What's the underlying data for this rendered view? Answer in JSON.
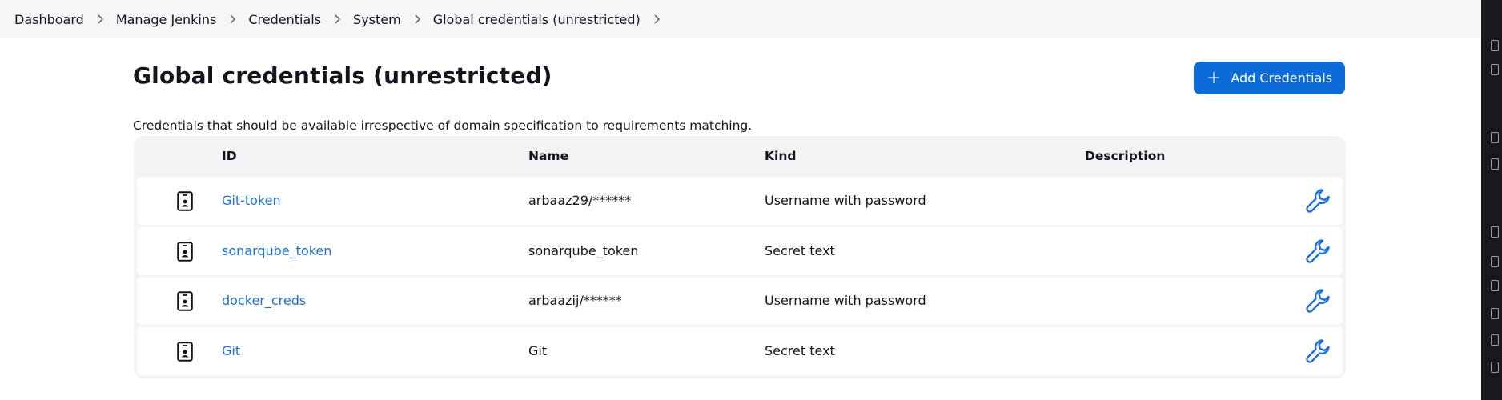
{
  "breadcrumb": [
    "Dashboard",
    "Manage Jenkins",
    "Credentials",
    "System",
    "Global credentials (unrestricted)"
  ],
  "title": "Global credentials (unrestricted)",
  "add_button": {
    "label": "Add Credentials",
    "icon": "plus-icon"
  },
  "description": "Credentials that should be available irrespective of domain specification to requirements matching.",
  "table": {
    "headers": [
      "ID",
      "Name",
      "Kind",
      "Description"
    ],
    "rows": [
      {
        "id": "Git-token",
        "name": "arbaaz29/******",
        "kind": "Username with password",
        "description": ""
      },
      {
        "id": "sonarqube_token",
        "name": "sonarqube_token",
        "kind": "Secret text",
        "description": ""
      },
      {
        "id": "docker_creds",
        "name": "arbaazij/******",
        "kind": "Username with password",
        "description": ""
      },
      {
        "id": "Git",
        "name": "Git",
        "kind": "Secret text",
        "description": ""
      }
    ],
    "row_icon": "credential-icon",
    "action_icon": "wrench-icon"
  },
  "colors": {
    "accent": "#0b6bd9",
    "link": "#1f6fd6",
    "breadcrumb_bg": "#f6f6f8",
    "table_bg": "#f3f3f6"
  }
}
